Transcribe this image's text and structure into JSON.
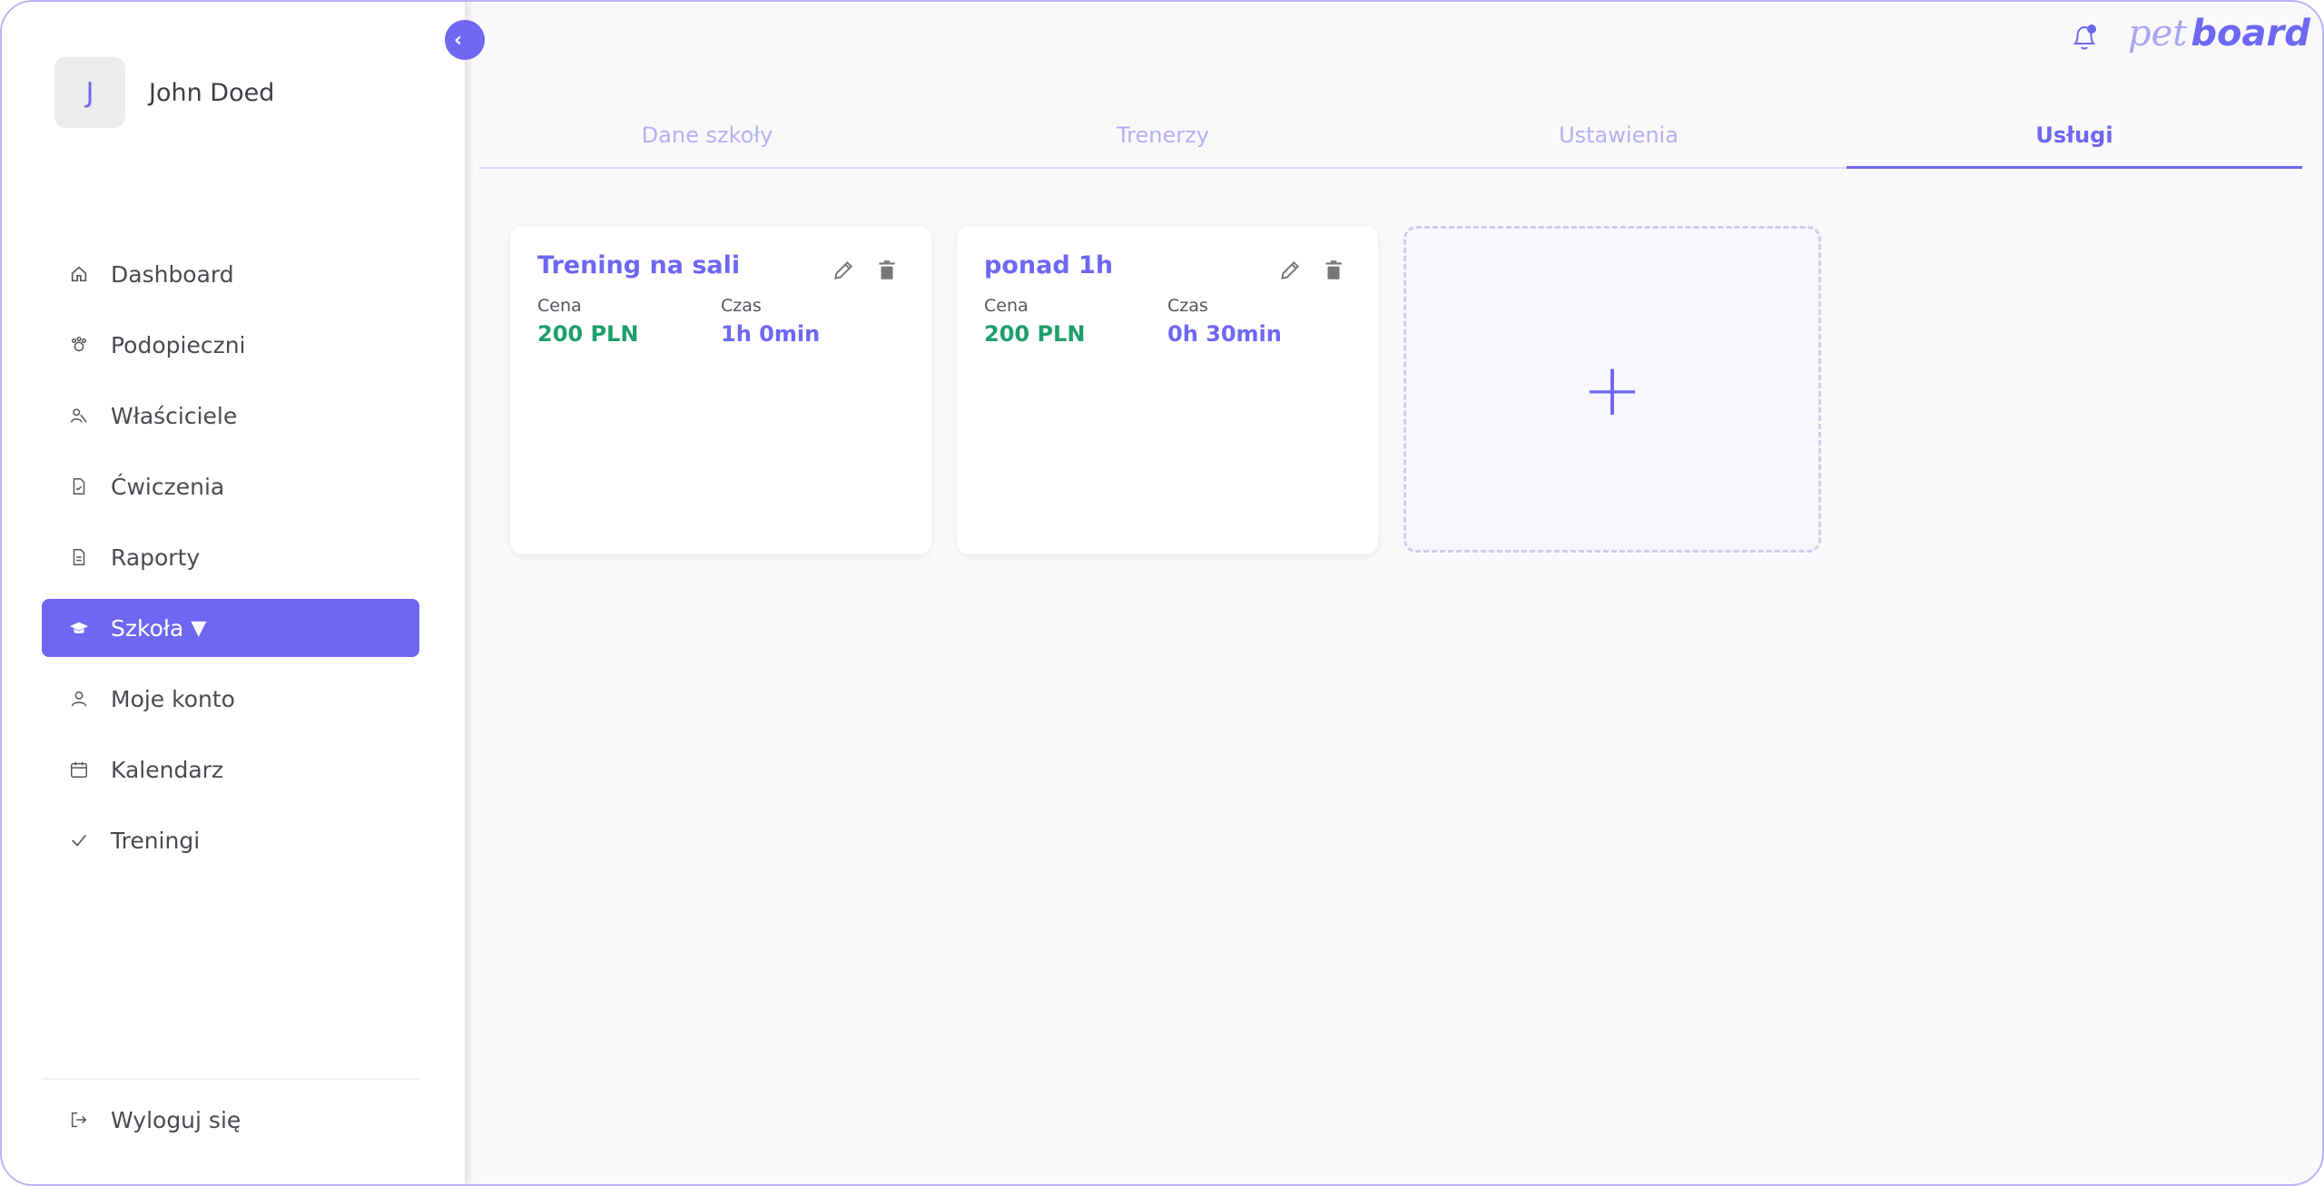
{
  "user": {
    "initial": "J",
    "name": "John Doed"
  },
  "sidebar": {
    "items": [
      {
        "label": "Dashboard",
        "icon": "home-icon"
      },
      {
        "label": "Podopieczni",
        "icon": "paw-icon"
      },
      {
        "label": "Właściciele",
        "icon": "users-icon"
      },
      {
        "label": "Ćwiczenia",
        "icon": "file-check-icon"
      },
      {
        "label": "Raporty",
        "icon": "document-icon"
      },
      {
        "label": "Szkoła",
        "icon": "graduation-cap-icon",
        "active": true,
        "caret": "▼"
      },
      {
        "label": "Moje konto",
        "icon": "user-icon"
      },
      {
        "label": "Kalendarz",
        "icon": "calendar-icon"
      },
      {
        "label": "Treningi",
        "icon": "check-icon"
      }
    ],
    "logout": {
      "label": "Wyloguj się",
      "icon": "logout-icon"
    },
    "collapse_icon": "chevron-left-icon"
  },
  "header": {
    "logo_pet": "pet",
    "logo_board": "board",
    "bell_icon": "bell-icon"
  },
  "tabs": [
    {
      "label": "Dane szkoły"
    },
    {
      "label": "Trenerzy"
    },
    {
      "label": "Ustawienia"
    },
    {
      "label": "Usługi",
      "active": true
    }
  ],
  "services": [
    {
      "title": "Trening na sali",
      "price_label": "Cena",
      "price": "200 PLN",
      "time_label": "Czas",
      "time": "1h 0min"
    },
    {
      "title": "ponad 1h",
      "price_label": "Cena",
      "price": "200 PLN",
      "time_label": "Czas",
      "time": "0h 30min"
    }
  ],
  "add_card": {
    "symbol": "+"
  },
  "colors": {
    "accent": "#6d67f2",
    "price": "#1e9e6a",
    "tab_inactive": "#b3b0f0"
  }
}
